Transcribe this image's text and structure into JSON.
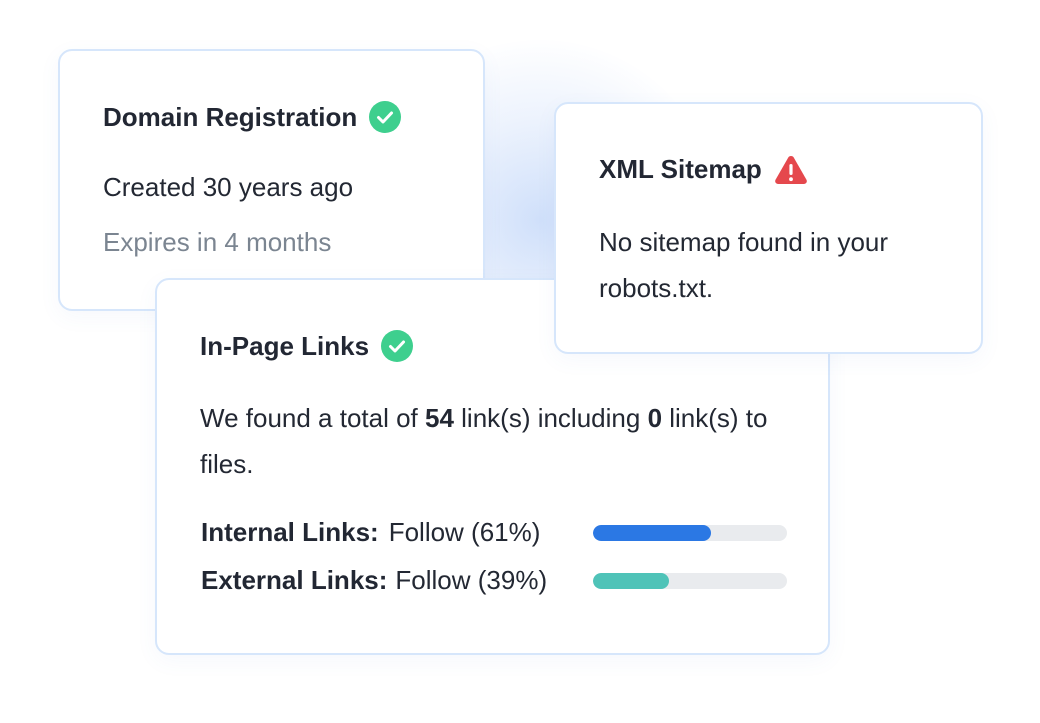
{
  "domain_card": {
    "title": "Domain Registration",
    "created": "Created 30 years ago",
    "expires": "Expires in 4 months",
    "status_icon": "check-circle-icon"
  },
  "sitemap_card": {
    "title": "XML Sitemap",
    "message_line1": "No sitemap found in your",
    "message_line2": "robots.txt.",
    "status_icon": "warning-triangle-icon"
  },
  "links_card": {
    "title": "In-Page Links",
    "status_icon": "check-circle-icon",
    "summary_prefix": "We found a total of ",
    "total_links": "54",
    "summary_middle": " link(s) including ",
    "file_links": "0",
    "summary_suffix": " link(s) to files.",
    "internal": {
      "label": "Internal Links:",
      "value": "Follow (61%)",
      "percent": 61,
      "color": "#2b78e4"
    },
    "external": {
      "label": "External Links:",
      "value": "Follow (39%)",
      "percent": 39,
      "color": "#4fc3b8"
    }
  },
  "colors": {
    "success": "#3ecf8e",
    "warning": "#e5484d",
    "card_border": "#d6e6fb",
    "bar_track": "#e9ebee"
  }
}
